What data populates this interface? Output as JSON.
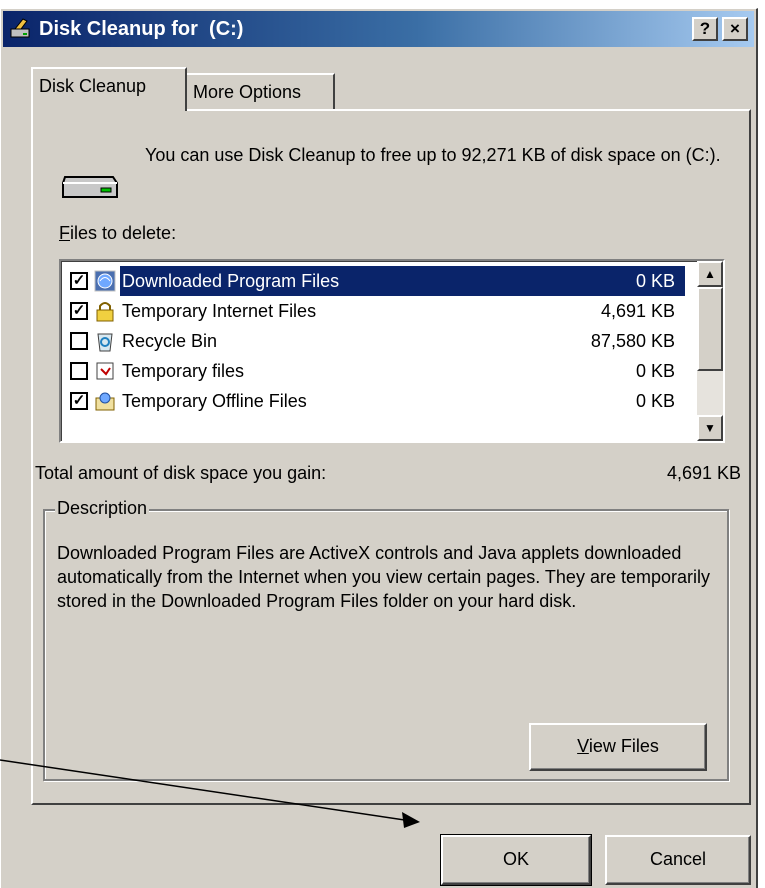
{
  "window": {
    "title": "Disk Cleanup for  (C:)",
    "help_button": "?",
    "close_button": "×"
  },
  "tabs": [
    {
      "label": "Disk Cleanup",
      "active": true
    },
    {
      "label": "More Options",
      "active": false
    }
  ],
  "intro_text": "You can use Disk Cleanup to free up to 92,271 KB of disk space on  (C:).",
  "files_label": {
    "accel": "F",
    "rest": "iles to delete:"
  },
  "files": [
    {
      "name": "Downloaded Program Files",
      "size": "0 KB",
      "checked": true,
      "selected": true,
      "icon": "globe-icon"
    },
    {
      "name": "Temporary Internet Files",
      "size": "4,691 KB",
      "checked": true,
      "selected": false,
      "icon": "lock-icon"
    },
    {
      "name": "Recycle Bin",
      "size": "87,580 KB",
      "checked": false,
      "selected": false,
      "icon": "recycle-bin-icon"
    },
    {
      "name": "Temporary files",
      "size": "0 KB",
      "checked": false,
      "selected": false,
      "icon": "temp-file-icon"
    },
    {
      "name": "Temporary Offline Files",
      "size": "0 KB",
      "checked": true,
      "selected": false,
      "icon": "offline-files-icon"
    }
  ],
  "total": {
    "label": "Total amount of disk space you gain:",
    "value": "4,691 KB"
  },
  "description": {
    "title": "Description",
    "text": "Downloaded Program Files are ActiveX controls and Java applets downloaded automatically from the Internet when you view certain pages. They are temporarily stored in the Downloaded Program Files folder on your hard disk."
  },
  "buttons": {
    "view_files": {
      "accel": "V",
      "rest": "iew Files"
    },
    "ok": "OK",
    "cancel": "Cancel"
  },
  "colors": {
    "accent": "#0a246a",
    "face": "#d4d0c8"
  }
}
